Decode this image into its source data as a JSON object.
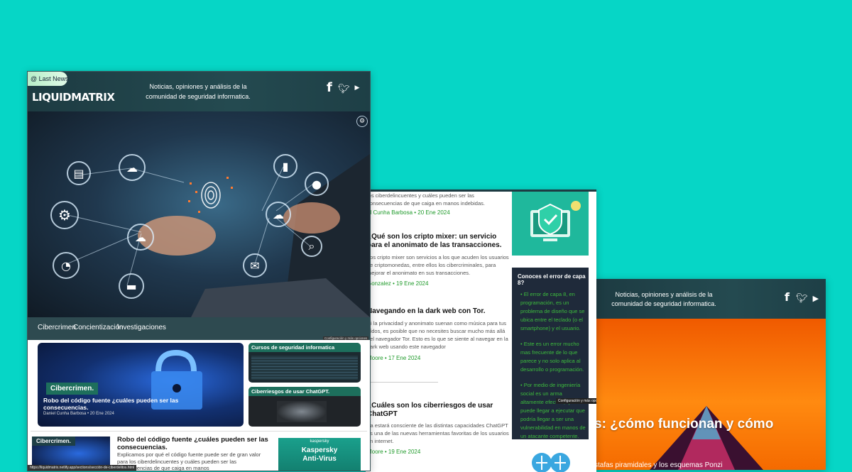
{
  "colors": {
    "background": "#06d6c6",
    "header": "#1d3b42",
    "accent_green": "#1f9a2a",
    "sidebar_dark": "#1f2a3a"
  },
  "left_window": {
    "badge": "@ Last News",
    "logo": "LIQUIDMATRIX",
    "tagline_line1": "Noticias, opiniones y análisis de la",
    "tagline_line2": "comunidad de seguridad informatica.",
    "social_icons": [
      "facebook-icon",
      "twitter-icon",
      "youtube-icon"
    ],
    "nav": [
      "Cibercrimen",
      "Concientización",
      "Investigaciones"
    ],
    "config_label": "Configuración y más opciones",
    "featured": {
      "category": "Cibercrimen.",
      "title": "Robo del código fuente ¿cuáles pueden ser las consecuencias.",
      "meta": "Daniel Cunha Barbosa  •  20 Ene 2024"
    },
    "side_cards": [
      {
        "title": "Cursos de seguridad informatica"
      },
      {
        "title": "Ciberriesgos de usar ChatGPT."
      }
    ],
    "article": {
      "category": "Cibercrimen.",
      "title": "Robo del código fuente ¿cuáles pueden ser las consecuencias.",
      "excerpt": "Explicamos por qué el código fuente puede ser de gran valor para los ciberdelincuentes y cuáles pueden ser las consecuencias de que caiga en manos"
    },
    "ad": {
      "brand": "kaspersky",
      "product_line1": "Kaspersky",
      "product_line2": "Anti-Virus"
    },
    "status_url": "https://liquidmatrix.netlify.app/sections/sección-de-ciberdelitos.html"
  },
  "middle_window": {
    "top_excerpt_line1": "los ciberdelincuentes y cuáles pueden ser las",
    "top_excerpt_line2": "consecuencias de que caiga en manos indebidas.",
    "top_meta": "el Cunha Barbosa  •  20 Ene 2024",
    "articles": [
      {
        "title": "¿Qué son los cripto mixer: un servicio para el anonimato de las transacciones.",
        "excerpt": "Los cripto mixer son servicios a los que acuden los usuarios de criptomonedas, entre ellos los cibercriminales, para mejorar el anonimato en sus transacciones.",
        "meta": "Gonzalez  •  19 Ene 2024"
      },
      {
        "title": "Navegando en la dark web con Tor.",
        "excerpt": "Si la privacidad y anonimato suenan como música para tus oídos, es posible que no necesites buscar mucho más allá del navegador Tor.  Esto es lo que se siente al navegar en la dark web usando este navegador",
        "meta": "Moore  •  17 Ene 2024"
      },
      {
        "title": "¿Cuáles son los ciberriesgos de usar ChatGPT",
        "excerpt": "Ya estará consciente de las distintas capacidades ChatGPT es una de las nuevas herramientas favoritas de los usuarios en internet.",
        "meta": "Moore  •  19 Ene 2024"
      }
    ],
    "sidebar": {
      "title": "Conoces el error de capa 8?",
      "bullets": [
        "• El error de capa 8, en programación, es un problema de diseño que se ubica entre el teclado (o el smartphone) y el usuario.",
        "• Este es un error mucho mas frecuente de lo que parece y no solo aplica al desarrollo o programación.",
        "• Por medio de ingeniería social es un arma altamente efectiva, que puede llegar a ejecutar que podría llegar a ser una vulnerabilidad en manos de un atacante competente."
      ],
      "config_label": "Configuración y más opciones"
    }
  },
  "right_window": {
    "tagline_line1": "Noticias, opiniones y análisis de la",
    "tagline_line2": "comunidad de seguridad informatica.",
    "hero_title": "s: ¿cómo funcionan y cómo",
    "hero_caption": "stafas piramidales y los esquemas Ponzi"
  }
}
